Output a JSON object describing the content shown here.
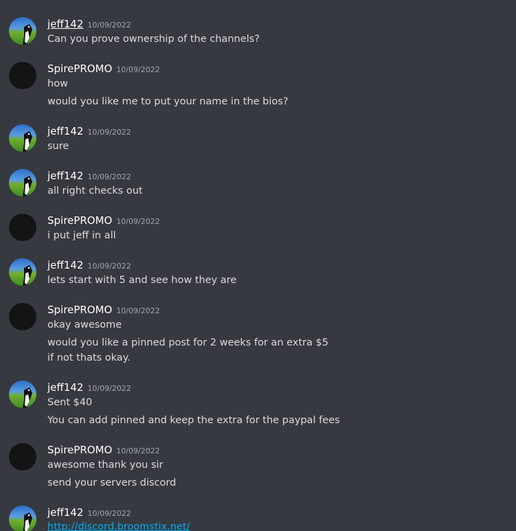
{
  "messages": [
    {
      "author": "jeff142",
      "time": "10/09/2022",
      "avatar": "jeff-avatar",
      "lines": [
        "Can you prove ownership of the channels?"
      ]
    },
    {
      "author": "SpirePROMO",
      "time": "10/09/2022",
      "avatar": "dark-avatar",
      "lines": [
        "how",
        "would you like me to put your name in the bios?"
      ]
    },
    {
      "author": "jeff142",
      "time": "10/09/2022",
      "avatar": "jeff-avatar",
      "lines": [
        "sure"
      ]
    },
    {
      "author": "jeff142",
      "time": "10/09/2022",
      "avatar": "jeff-avatar",
      "lines": [
        "all right checks out"
      ]
    },
    {
      "author": "SpirePROMO",
      "time": "10/09/2022",
      "avatar": "dark-avatar",
      "lines": [
        "i put jeff in all"
      ]
    },
    {
      "author": "jeff142",
      "time": "10/09/2022",
      "avatar": "jeff-avatar",
      "lines": [
        "lets start with 5 and see how they are"
      ]
    },
    {
      "author": "SpirePROMO",
      "time": "10/09/2022",
      "avatar": "dark-avatar",
      "lines": [
        "okay awesome",
        "would you like a pinned post for 2 weeks for an extra $5",
        "if not thats okay."
      ]
    },
    {
      "author": "jeff142",
      "time": "10/09/2022",
      "avatar": "jeff-avatar",
      "lines": [
        "Sent $40",
        "You can add pinned and keep the extra for the paypal fees"
      ]
    },
    {
      "author": "SpirePROMO",
      "time": "10/09/2022",
      "avatar": "dark-avatar",
      "lines": [
        "awesome thank you sir",
        "send your servers discord"
      ]
    },
    {
      "author": "jeff142",
      "time": "10/09/2022",
      "avatar": "jeff-avatar",
      "lines": [
        "http://discord.broomstix.net/"
      ],
      "is_link": true
    }
  ],
  "colors": {
    "background": "#36393f",
    "text": "#dcddde",
    "username": "#ffffff",
    "timestamp": "#a3a6aa",
    "link": "#00aff4"
  }
}
